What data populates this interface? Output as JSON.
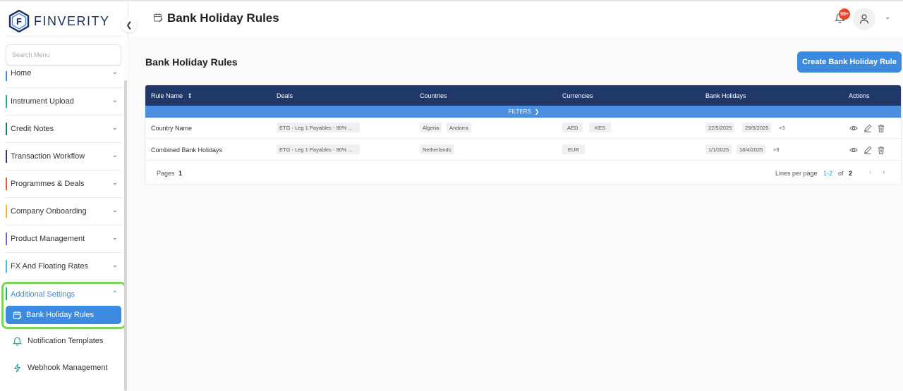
{
  "brand": {
    "name": "FINVERITY",
    "logo_letter": "F"
  },
  "sidebar": {
    "search_placeholder": "Search Menu",
    "items": [
      {
        "label": "Home",
        "color": "#3d8be0"
      },
      {
        "label": "Instrument Upload",
        "color": "#2aa876"
      },
      {
        "label": "Credit Notes",
        "color": "#1e7a5a"
      },
      {
        "label": "Transaction Workflow",
        "color": "#3b2f7a"
      },
      {
        "label": "Programmes & Deals",
        "color": "#e8583d"
      },
      {
        "label": "Company Onboarding",
        "color": "#f2b233"
      },
      {
        "label": "Product Management",
        "color": "#7b5fd4"
      },
      {
        "label": "FX And Floating Rates",
        "color": "#42b8e8"
      },
      {
        "label": "Additional Settings",
        "color": "#2aa876"
      }
    ],
    "subitems": [
      {
        "label": "Bank Holiday Rules",
        "active": true
      },
      {
        "label": "Notification Templates"
      },
      {
        "label": "Webhook Management"
      }
    ]
  },
  "header": {
    "title": "Bank Holiday Rules",
    "notification_badge": "99+"
  },
  "main": {
    "heading": "Bank Holiday Rules",
    "create_button": "Create Bank Holiday Rule",
    "columns": [
      "Rule Name",
      "Deals",
      "Countries",
      "Currencies",
      "Bank Holidays",
      "Actions"
    ],
    "filters_label": "FILTERS",
    "rows": [
      {
        "name": "Country Name",
        "deal": "ETG - Leg 1 Payables - 90% ...",
        "countries": [
          "Algeria",
          "Andorra"
        ],
        "currencies": [
          "AED",
          "KES"
        ],
        "holidays": [
          "22/5/2025",
          "29/5/2025"
        ],
        "holidays_more": "+3"
      },
      {
        "name": "Combined Bank Holidays",
        "deal": "ETG - Leg 1 Payables - 90% ...",
        "countries": [
          "Netherlands"
        ],
        "currencies": [
          "EUR"
        ],
        "holidays": [
          "1/1/2025",
          "18/4/2025"
        ],
        "holidays_more": "+9"
      }
    ],
    "footer": {
      "pages_label": "Pages",
      "pages_value": "1",
      "lines_label": "Lines per page",
      "range": "1-2",
      "of_label": "of",
      "total": "2"
    }
  }
}
